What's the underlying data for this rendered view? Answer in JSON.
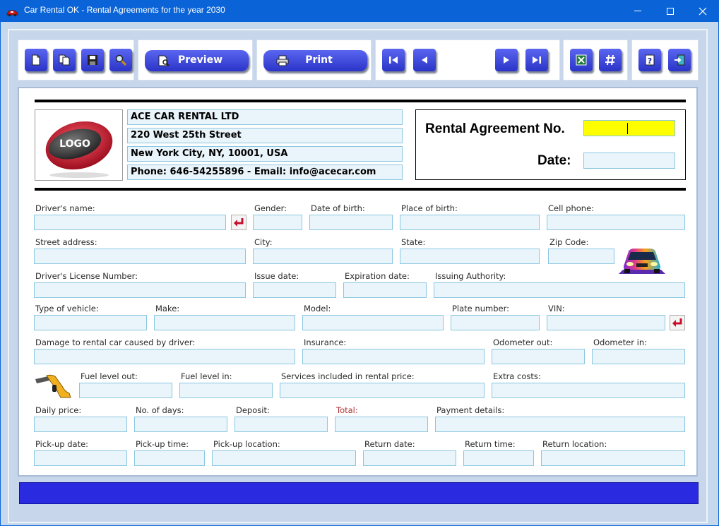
{
  "window": {
    "title": "Car Rental OK - Rental Agreements for the year 2030",
    "app_icon": "red-car-icon",
    "controls": [
      "minimize-icon",
      "maximize-icon",
      "close-icon"
    ]
  },
  "toolbar": {
    "groups": [
      {
        "buttons": [
          "new-document-icon",
          "copy-document-icon",
          "save-icon",
          "search-icon"
        ]
      },
      {
        "buttons": [
          "preview-icon"
        ],
        "label": "Preview"
      },
      {
        "buttons": [
          "printer-icon"
        ],
        "label": "Print"
      },
      {
        "buttons": [
          "first-record-icon",
          "previous-record-icon",
          "next-record-icon",
          "last-record-icon"
        ]
      },
      {
        "buttons": [
          "excel-export-icon",
          "hash-icon"
        ]
      },
      {
        "buttons": [
          "help-icon",
          "exit-icon"
        ]
      }
    ],
    "preview_label": "Preview",
    "print_label": "Print"
  },
  "company": {
    "logo_text": "LOGO",
    "name": "ACE CAR RENTAL LTD",
    "street": "220 West 25th Street",
    "city": "New York City, NY, 10001, USA",
    "contact": "Phone: 646-54255896 - Email: info@acecar.com"
  },
  "agreement": {
    "number_label": "Rental Agreement No.",
    "number_value": "",
    "date_label": "Date:",
    "date_value": ""
  },
  "form": {
    "labels": {
      "driver_name": "Driver's name:",
      "gender": "Gender:",
      "date_of_birth": "Date of birth:",
      "place_of_birth": "Place of birth:",
      "cell_phone": "Cell phone:",
      "street_address": "Street address:",
      "city": "City:",
      "state": "State:",
      "zip_code": "Zip Code:",
      "license_number": "Driver's License Number:",
      "issue_date": "Issue date:",
      "expiration_date": "Expiration date:",
      "issuing_authority": "Issuing Authority:",
      "vehicle_type": "Type of vehicle:",
      "make": "Make:",
      "model": "Model:",
      "plate_number": "Plate number:",
      "vin": "VIN:",
      "damage": "Damage to rental car caused by driver:",
      "insurance": "Insurance:",
      "odometer_out": "Odometer out:",
      "odometer_in": "Odometer in:",
      "fuel_out": "Fuel level out:",
      "fuel_in": "Fuel level in:",
      "services": "Services included in rental price:",
      "extra_costs": "Extra costs:",
      "daily_price": "Daily price:",
      "num_days": "No. of days:",
      "deposit": "Deposit:",
      "total": "Total:",
      "payment_details": "Payment details:",
      "pickup_date": "Pick-up date:",
      "pickup_time": "Pick-up time:",
      "pickup_location": "Pick-up location:",
      "return_date": "Return date:",
      "return_time": "Return time:",
      "return_location": "Return location:"
    },
    "icons": {
      "driver_picker": "return-arrow-icon",
      "vehicle_picker": "return-arrow-icon",
      "car": "colorful-car-icon",
      "fuel": "fuel-nozzle-icon"
    },
    "accent_colors": {
      "total_label": "#b03030",
      "agreement_no_highlight": "#ffff00",
      "status_bar": "#2a2be0"
    }
  }
}
